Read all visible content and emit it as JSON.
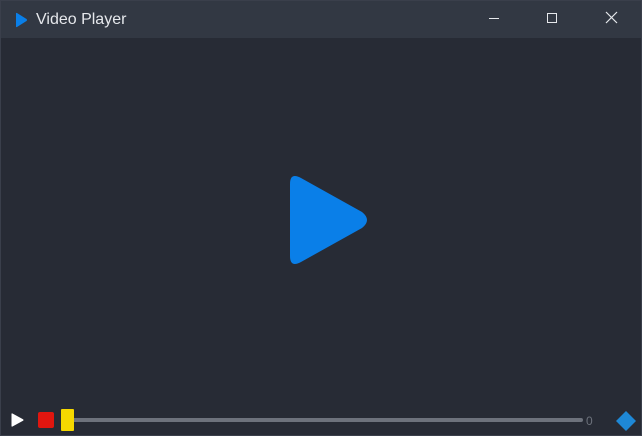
{
  "window": {
    "title": "Video Player",
    "app_icon": "play-triangle-icon",
    "buttons": [
      "minimize-icon",
      "maximize-icon",
      "close-icon"
    ]
  },
  "video": {
    "center_icon": "large-play-icon",
    "accent_color": "#0a7fe8"
  },
  "controls": {
    "play_icon": "play-icon",
    "stop_icon": "stop-icon",
    "stop_color": "#e0160f",
    "seek_handle_color": "#f5d800",
    "progress": 0,
    "time_value": "0",
    "volume_icon": "diamond-icon",
    "volume_color": "#1e88d6"
  }
}
